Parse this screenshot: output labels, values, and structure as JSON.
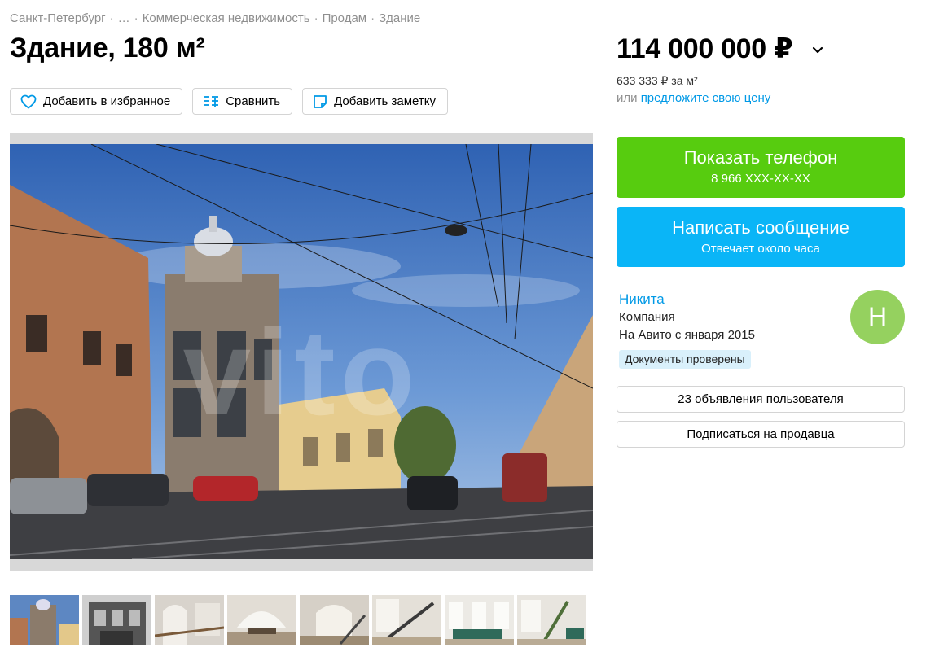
{
  "breadcrumbs": [
    "Санкт-Петербург",
    "…",
    "Коммерческая недвижимость",
    "Продам",
    "Здание"
  ],
  "breadcrumb_separator": "·",
  "title": "Здание, 180 м²",
  "actions": {
    "favorite": "Добавить в избранное",
    "compare": "Сравнить",
    "note": "Добавить заметку"
  },
  "gallery": {
    "watermark": "vito",
    "thumbnail_count": 8
  },
  "price": {
    "value": "114 000 000 ₽",
    "per_m2": "633 333 ₽ за м²",
    "offer_prefix": "или",
    "offer_link": "предложите свою цену"
  },
  "contact": {
    "phone_label": "Показать телефон",
    "phone_masked": "8 966 XXX-XX-XX",
    "message_label": "Написать сообщение",
    "message_sub": "Отвечает около часа"
  },
  "seller": {
    "name": "Никита",
    "type": "Компания",
    "since": "На Авито с января 2015",
    "badge": "Документы проверены",
    "avatar_letter": "Н",
    "ads_button": "23 объявления пользователя",
    "subscribe_button": "Подписаться на продавца"
  },
  "colors": {
    "phone_button": "#57cc0f",
    "message_button": "#0ab5f7",
    "link": "#0099e6",
    "avatar": "#95d15f",
    "badge_bg": "#d9f0fb"
  }
}
